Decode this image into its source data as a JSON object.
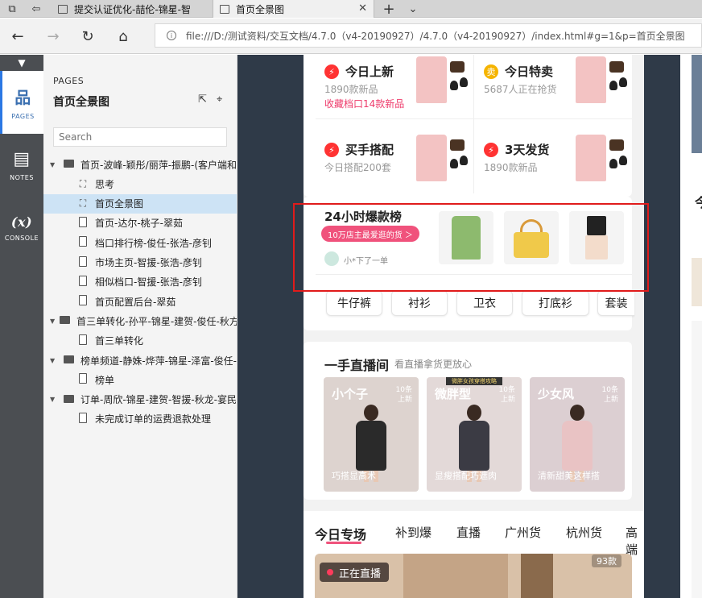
{
  "browser": {
    "tabs": [
      {
        "label": "提交认证优化-喆伦-锦星-智"
      },
      {
        "label": "首页全景图",
        "close": "✕"
      }
    ],
    "new_tab": "+",
    "tab_menu": "⌄",
    "url": "file:///D:/测试资料/交互文档/4.7.0（v4-20190927）/4.7.0（v4-20190927）/index.html#g=1&p=首页全景图"
  },
  "rail": {
    "items": [
      {
        "label": "PAGES",
        "glyph": "⛶"
      },
      {
        "label": "NOTES",
        "glyph": "▤"
      },
      {
        "label": "CONSOLE",
        "glyph": "(x)"
      }
    ]
  },
  "panel": {
    "heading": "PAGES",
    "title": "首页全景图",
    "search_placeholder": "Search",
    "tree": [
      {
        "label": "首页-波峰-颖彤/丽萍-振鹏-(客户端和",
        "type": "folder",
        "level": 0
      },
      {
        "label": "思考",
        "type": "flow",
        "level": 1
      },
      {
        "label": "首页全景图",
        "type": "flow",
        "level": 1,
        "selected": true
      },
      {
        "label": "首页-达尔-桃子-翠茹",
        "type": "page",
        "level": 1
      },
      {
        "label": "档口排行榜-俊任-张浩-彦钊",
        "type": "page",
        "level": 1
      },
      {
        "label": "市场主页-智援-张浩-彦钊",
        "type": "page",
        "level": 1
      },
      {
        "label": "相似档口-智援-张浩-彦钊",
        "type": "page",
        "level": 1
      },
      {
        "label": "首页配置后台-翠茹",
        "type": "page",
        "level": 1
      },
      {
        "label": "首三单转化-孙平-锦星-建贺-俊任-秋方",
        "type": "folder",
        "level": 0
      },
      {
        "label": "首三单转化",
        "type": "page",
        "level": 1
      },
      {
        "label": "榜单频道-静姝-烨萍-锦星-泽富-俊任-",
        "type": "folder",
        "level": 0
      },
      {
        "label": "榜单",
        "type": "page",
        "level": 1
      },
      {
        "label": "订单-周欣-锦星-建贺-智援-秋龙-宴民",
        "type": "folder",
        "level": 0
      },
      {
        "label": "未完成订单的运费退款处理",
        "type": "page",
        "level": 1
      }
    ]
  },
  "app": {
    "quad": [
      {
        "title": "今日上新",
        "sub": "1890款新品",
        "sub2": "收藏档口14款新品",
        "icon": "bolt-icon"
      },
      {
        "title": "今日特卖",
        "sub": "5687人正在抢货",
        "sub2": "",
        "icon": "sale-icon"
      },
      {
        "title": "买手搭配",
        "sub": "今日搭配200套",
        "sub2": "",
        "icon": "bolt-icon"
      },
      {
        "title": "3天发货",
        "sub": "1890款新品",
        "sub2": "",
        "icon": "bolt-icon"
      }
    ],
    "hot": {
      "title": "24小时爆款榜",
      "badge": "10万店主最爱逛的货 ＞",
      "buyer": "小*下了一单"
    },
    "tags": [
      "牛仔裤",
      "衬衫",
      "卫衣",
      "打底衫",
      "套装"
    ],
    "live_title": "一手直播间",
    "live_sub": "看直播拿货更放心",
    "lives": [
      {
        "title": "小个子",
        "count": "10条",
        "note": "上新",
        "caption": "巧搭显高术",
        "banner": ""
      },
      {
        "title": "微胖型",
        "count": "10条",
        "note": "上新",
        "caption": "显瘦搭配巧遮肉",
        "banner": "微胖女孩穿搭攻略"
      },
      {
        "title": "少女风",
        "count": "10条",
        "note": "上新",
        "caption": "清新甜美这样搭",
        "banner": ""
      }
    ],
    "categories": [
      "今日专场",
      "补到爆",
      "直播",
      "广州货",
      "杭州货",
      "高端"
    ],
    "live_badge": "正在直播",
    "count_badge": "93款"
  },
  "colors": {
    "accent_pink": "#f0527c",
    "highlight_red": "#e01b1b",
    "canvas": "#2f3a48"
  }
}
